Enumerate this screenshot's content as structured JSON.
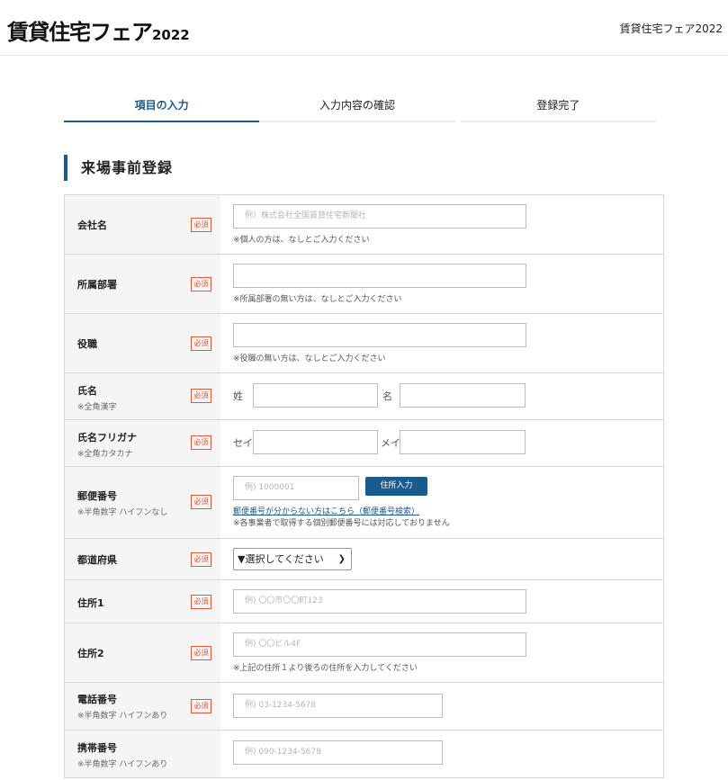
{
  "header": {
    "logo_text": "賃貸住宅フェア",
    "logo_year": "2022",
    "right_text": "賃貸住宅フェア2022"
  },
  "steps": [
    {
      "label": "項目の入力"
    },
    {
      "label": "入力内容の確認"
    },
    {
      "label": "登録完了"
    }
  ],
  "section_title": "来場事前登録",
  "required_label": "必須",
  "rows": {
    "company": {
      "label": "会社名",
      "placeholder": "例）株式会社全国賃貸住宅新聞社",
      "note": "※個人の方は、なしとご入力ください"
    },
    "department": {
      "label": "所属部署",
      "note": "※所属部署の無い方は、なしとご入力ください"
    },
    "position": {
      "label": "役職",
      "note": "※役職の無い方は、なしとご入力ください"
    },
    "name": {
      "label": "氏名",
      "sub": "※全角漢字",
      "first_tag": "姓",
      "last_tag": "名"
    },
    "furigana": {
      "label": "氏名フリガナ",
      "sub": "※全角カタカナ",
      "first_tag": "セイ",
      "last_tag": "メイ"
    },
    "postal": {
      "label": "郵便番号",
      "sub": "※半角数字 ハイフンなし",
      "placeholder": "例) 1000001",
      "button": "住所入力",
      "link": "郵便番号が分からない方はこちら（郵便番号検索）",
      "note": "※各事業者で取得する個別郵便番号には対応しておりません"
    },
    "prefecture": {
      "label": "都道府県",
      "selected": "▼選択してください"
    },
    "address1": {
      "label": "住所1",
      "placeholder": "例) 〇〇市〇〇町123"
    },
    "address2": {
      "label": "住所2",
      "placeholder": "例) 〇〇ビル4F",
      "note": "※上記の住所１より後ろの住所を入力してください"
    },
    "phone": {
      "label": "電話番号",
      "sub": "※半角数字 ハイフンあり",
      "placeholder": "例) 03-1234-5678"
    },
    "mobile": {
      "label": "携帯番号",
      "sub": "※半角数字 ハイフンあり",
      "placeholder": "例) 090-1234-5678"
    }
  },
  "colors": {
    "accent": "#1b5a8e",
    "required": "#e05a3a"
  }
}
